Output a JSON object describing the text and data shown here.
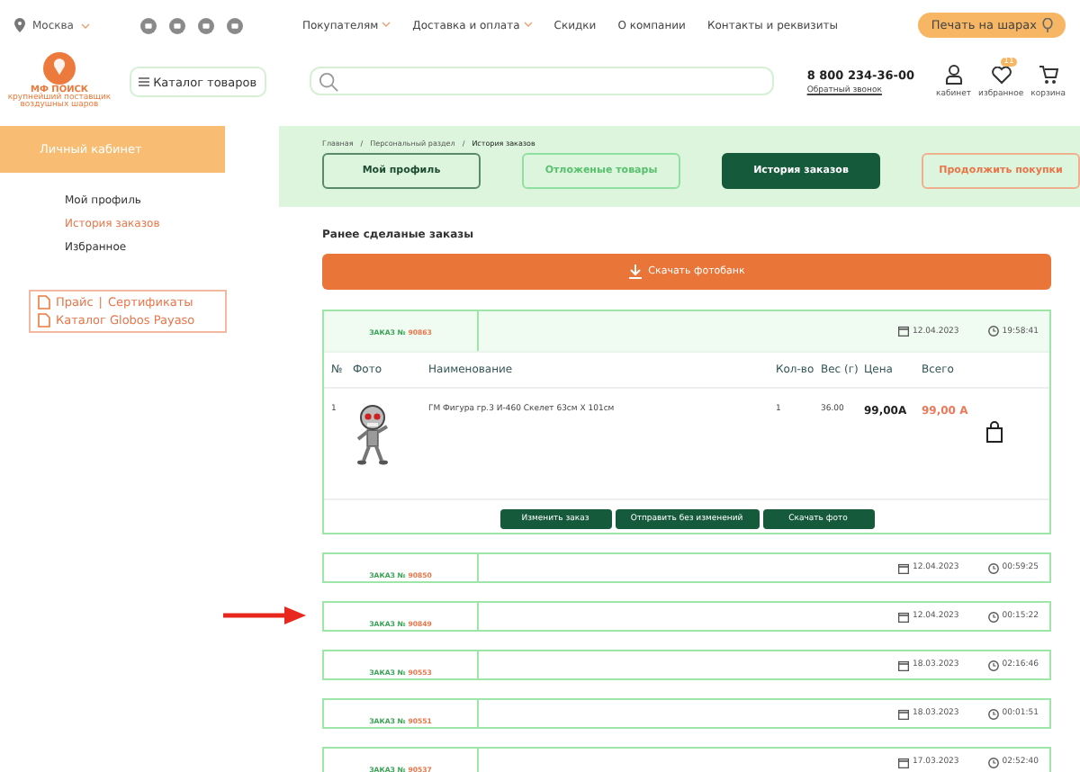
{
  "header": {
    "city": "Москва",
    "nav": [
      {
        "label": "Покупателям",
        "dropdown": true
      },
      {
        "label": "Доставка и оплата",
        "dropdown": true
      },
      {
        "label": "Скидки",
        "dropdown": false
      },
      {
        "label": "О компании",
        "dropdown": false
      },
      {
        "label": "Контакты и реквизиты",
        "dropdown": false
      }
    ],
    "print_button": "Печать на шарах",
    "logo": {
      "name": "МФ ПОИСК",
      "tagline": "крупнейший поставщик воздушных шаров"
    },
    "catalog_button": "Каталог товаров",
    "phone": "8 800 234-36-00",
    "callback": "Обратный звонок",
    "user_icons": [
      {
        "kind": "user",
        "label": "кабинет"
      },
      {
        "kind": "heart",
        "label": "избранное",
        "badge": "11"
      },
      {
        "kind": "cart",
        "label": "корзина"
      }
    ]
  },
  "sidebar": {
    "title": "Личный кабинет",
    "items": [
      {
        "label": "Мой профиль",
        "selected": false
      },
      {
        "label": "История заказов",
        "selected": true
      },
      {
        "label": "Избранное",
        "selected": false
      }
    ],
    "links": {
      "price": "Прайс",
      "separator": "|",
      "certificates": "Сертификаты",
      "catalog": "Каталог Globos Payaso"
    }
  },
  "breadcrumbs": [
    {
      "kind": "link",
      "text": "Главная"
    },
    {
      "kind": "separator",
      "text": "/"
    },
    {
      "kind": "link",
      "text": "Персональный раздел"
    },
    {
      "kind": "separator",
      "text": "/"
    },
    {
      "kind": "current",
      "text": "История заказов"
    }
  ],
  "tabs": [
    {
      "label": "Мой профиль",
      "kind": "dark",
      "selected": false
    },
    {
      "label": "Отложеные товары",
      "kind": "green",
      "selected": false
    },
    {
      "label": "История заказов",
      "kind": "dark",
      "selected": true
    },
    {
      "label": "Продолжить покупки",
      "kind": "orange",
      "selected": false
    }
  ],
  "section_title": "Ранее сделаные заказы",
  "download_button": "Скачать фотобанк",
  "columns": [
    "№",
    "Фото",
    "Наименование",
    "Кол-во",
    "Вес (г)",
    "Цена",
    "Всего"
  ],
  "orders": [
    {
      "label": "ЗАКАЗ №",
      "number": "90863",
      "date": "12.04.2023",
      "time": "19:58:41",
      "expanded": true,
      "marked": false,
      "items": [
        {
          "num": "1",
          "name": "ГМ Фигура гр.3 И-460 Скелет 63см X 101см",
          "qty": "1",
          "weight": "36.00",
          "price": "99,00А",
          "total": "99,00 А"
        }
      ],
      "actions": [
        "Изменить заказ",
        "Отправить без изменений",
        "Скачать фото"
      ]
    },
    {
      "label": "ЗАКАЗ №",
      "number": "90850",
      "date": "12.04.2023",
      "time": "00:59:25",
      "expanded": false,
      "marked": false
    },
    {
      "label": "ЗАКАЗ №",
      "number": "90849",
      "date": "12.04.2023",
      "time": "00:15:22",
      "expanded": false,
      "marked": true
    },
    {
      "label": "ЗАКАЗ №",
      "number": "90553",
      "date": "18.03.2023",
      "time": "02:16:46",
      "expanded": false,
      "marked": false
    },
    {
      "label": "ЗАКАЗ №",
      "number": "90551",
      "date": "18.03.2023",
      "time": "00:01:51",
      "expanded": false,
      "marked": false
    },
    {
      "label": "ЗАКАЗ №",
      "number": "90537",
      "date": "17.03.2023",
      "time": "02:52:40",
      "expanded": false,
      "marked": false
    }
  ]
}
